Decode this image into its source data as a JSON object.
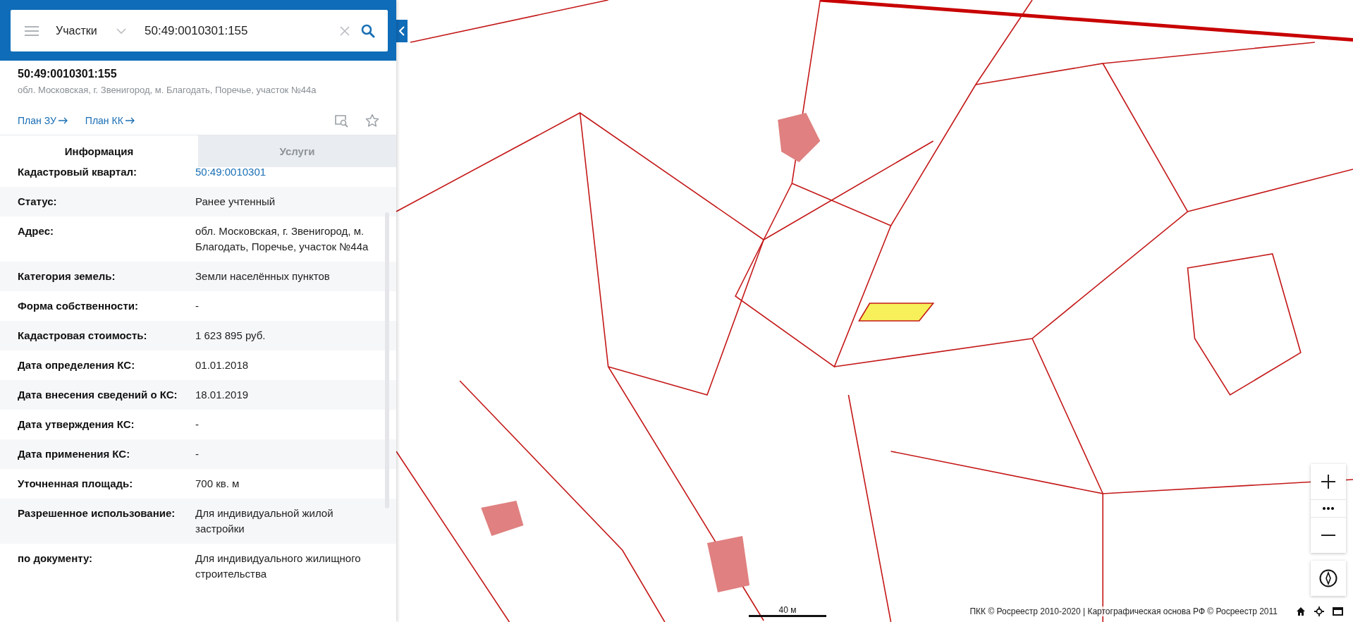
{
  "search_bar": {
    "category": "Участки",
    "value": "50:49:0010301:155"
  },
  "object": {
    "title": "50:49:0010301:155",
    "address": "обл. Московская, г. Звенигород, м. Благодать, Поречье, участок №44а",
    "links": [
      "План ЗУ",
      "План КК"
    ]
  },
  "tabs": [
    {
      "label": "Информация",
      "selected": true
    },
    {
      "label": "Услуги",
      "selected": false
    }
  ],
  "attributes": [
    {
      "label": "Кадастровый квартал:",
      "value": "50:49:0010301",
      "kind": "link"
    },
    {
      "label": "Статус:",
      "value": "Ранее учтенный",
      "kind": "text"
    },
    {
      "label": "Адрес:",
      "value": "обл. Московская, г. Звенигород, м. Благодать, Поречье, участок №44а",
      "kind": "text"
    },
    {
      "label": "Категория земель:",
      "value": "Земли населённых пунктов",
      "kind": "text"
    },
    {
      "label": "Форма собственности:",
      "value": "-",
      "kind": "text"
    },
    {
      "label": "Кадастровая стоимость:",
      "value": "1 623 895 руб.",
      "kind": "text"
    },
    {
      "label": "Дата определения КС:",
      "value": "01.01.2018",
      "kind": "text"
    },
    {
      "label": "Дата внесения сведений о КС:",
      "value": "18.01.2019",
      "kind": "text"
    },
    {
      "label": "Дата утверждения КС:",
      "value": "-",
      "kind": "text"
    },
    {
      "label": "Дата применения КС:",
      "value": "-",
      "kind": "text"
    },
    {
      "label": "Уточненная площадь:",
      "value": "700 кв. м",
      "kind": "text"
    },
    {
      "label": "Разрешенное использование:",
      "value": "Для индивидуальной жилой застройки",
      "kind": "text"
    },
    {
      "label": "по документу:",
      "value": "Для индивидуального жилищного строительства",
      "kind": "text"
    }
  ],
  "map": {
    "kind": "picture",
    "scale": "40 м",
    "attribution": "ПКК © Росреестр 2010-2020 | Картографическая основа РФ © Росреестр 2011"
  }
}
